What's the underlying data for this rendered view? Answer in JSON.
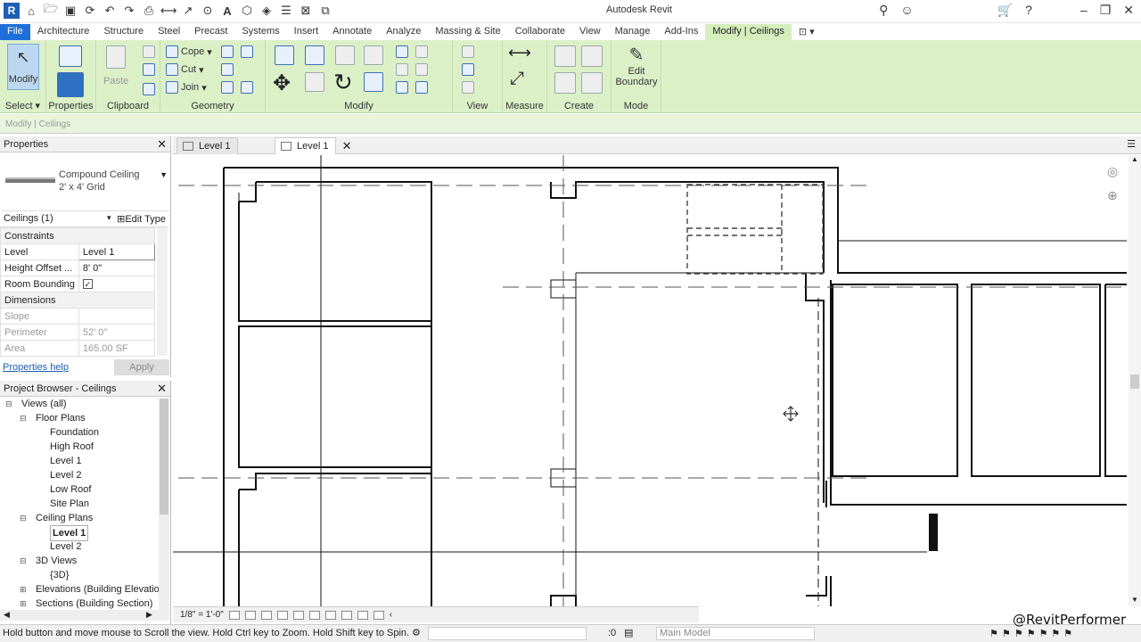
{
  "app": {
    "title": "Autodesk Revit",
    "quick_access_icons": [
      "revit-logo-icon",
      "open-icon",
      "save-icon",
      "sync-icon",
      "undo-icon",
      "redo-icon",
      "print-icon",
      "measure-icon",
      "dimension-icon",
      "text-icon",
      "3d-view-icon",
      "section-icon",
      "thin-lines-icon",
      "close-hidden-icon",
      "switch-windows-icon"
    ],
    "right_icons": [
      "binoculars-icon",
      "user-icon",
      "cart-icon",
      "help-icon",
      "minimize-icon",
      "restore-icon",
      "close-icon"
    ]
  },
  "ribbon_tabs": [
    "File",
    "Architecture",
    "Structure",
    "Steel",
    "Precast",
    "Systems",
    "Insert",
    "Annotate",
    "Analyze",
    "Massing & Site",
    "Collaborate",
    "View",
    "Manage",
    "Add-Ins",
    "Modify | Ceilings"
  ],
  "ribbon": {
    "modify_label": "Modify",
    "select_label": "Select",
    "properties_label": "Properties",
    "clipboard_label": "Clipboard",
    "paste_label": "Paste",
    "geometry_label": "Geometry",
    "cope_label": "Cope",
    "cut_label": "Cut",
    "join_label": "Join",
    "modify_panel_label": "Modify",
    "view_label": "View",
    "measure_label": "Measure",
    "create_label": "Create",
    "edit_boundary_label_1": "Edit",
    "edit_boundary_label_2": "Boundary",
    "mode_label": "Mode"
  },
  "context_bar": "Modify | Ceilings",
  "properties": {
    "title": "Properties",
    "type_name_1": "Compound Ceiling",
    "type_name_2": "2' x 4' Grid",
    "instance": "Ceilings (1)",
    "edit_type": "Edit Type",
    "sections": {
      "constraints": "Constraints",
      "dimensions": "Dimensions"
    },
    "rows": {
      "level_key": "Level",
      "level_val": "Level 1",
      "height_key": "Height Offset ...",
      "height_val": "8'  0\"",
      "room_key": "Room Bounding",
      "room_val": "✓",
      "slope_key": "Slope",
      "slope_val": "",
      "perimeter_key": "Perimeter",
      "perimeter_val": "52'  0\"",
      "area_key": "Area",
      "area_val": "165.00 SF"
    },
    "help": "Properties help",
    "apply": "Apply"
  },
  "browser": {
    "title": "Project Browser - Ceilings",
    "nodes": [
      {
        "label": "Views (all)",
        "level": 0,
        "toggle": "⊟"
      },
      {
        "label": "Floor Plans",
        "level": 1,
        "toggle": "⊟"
      },
      {
        "label": "Foundation",
        "level": 2
      },
      {
        "label": "High Roof",
        "level": 2
      },
      {
        "label": "Level 1",
        "level": 2
      },
      {
        "label": "Level 2",
        "level": 2
      },
      {
        "label": "Low Roof",
        "level": 2
      },
      {
        "label": "Site Plan",
        "level": 2
      },
      {
        "label": "Ceiling Plans",
        "level": 1,
        "toggle": "⊟"
      },
      {
        "label": "Level 1",
        "level": 2,
        "selected": true
      },
      {
        "label": "Level 2",
        "level": 2
      },
      {
        "label": "3D Views",
        "level": 1,
        "toggle": "⊟"
      },
      {
        "label": "{3D}",
        "level": 2
      },
      {
        "label": "Elevations (Building Elevation",
        "level": 1,
        "toggle": "⊞"
      },
      {
        "label": "Sections (Building Section)",
        "level": 1,
        "toggle": "⊞"
      }
    ]
  },
  "view_tabs": [
    {
      "label": "Level 1",
      "active": false
    },
    {
      "label": "Level 1",
      "active": true
    }
  ],
  "view_bar": {
    "scale": "1/8\" = 1'-0\""
  },
  "status": {
    "message": "Hold button and move mouse to Scroll the view. Hold Ctrl key to Zoom. Hold Shift key to Spin.",
    "zero": ":0",
    "model": "Main Model"
  },
  "watermark": "@RevitPerformer",
  "colors": {
    "file_tab": "#1e6fd9",
    "context_tab": "#d4eebc",
    "ribbon_bg": "#dcf0c8"
  }
}
